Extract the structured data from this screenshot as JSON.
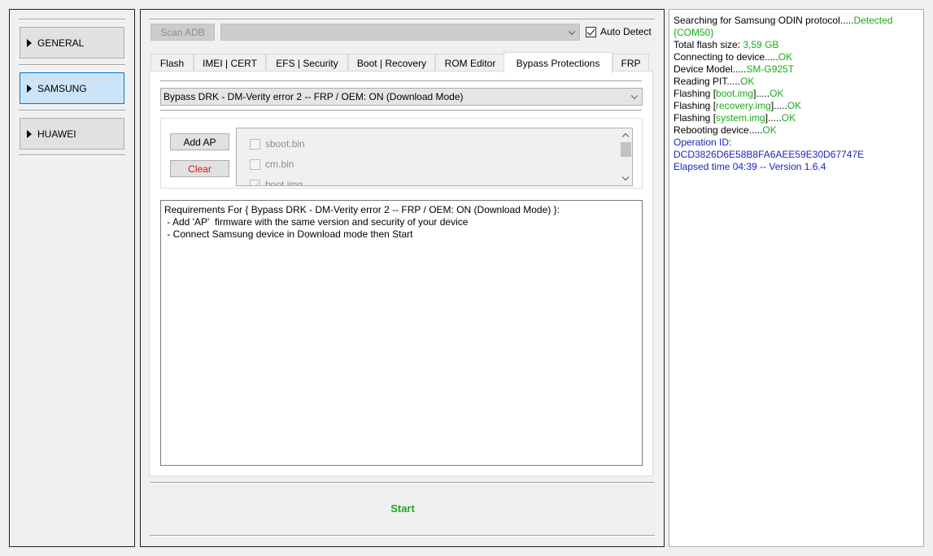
{
  "sidebar": {
    "items": [
      {
        "label": "GENERAL",
        "active": false
      },
      {
        "label": "SAMSUNG",
        "active": true
      },
      {
        "label": "HUAWEI",
        "active": false
      }
    ]
  },
  "toolbar": {
    "scan_adb_label": "Scan ADB",
    "device_combo_value": "",
    "auto_detect_label": "Auto Detect",
    "auto_detect_checked": true
  },
  "tabs": [
    {
      "label": "Flash"
    },
    {
      "label": "IMEI | CERT"
    },
    {
      "label": "EFS | Security"
    },
    {
      "label": "Boot | Recovery"
    },
    {
      "label": "ROM Editor"
    },
    {
      "label": "Bypass Protections",
      "active": true
    },
    {
      "label": "FRP"
    }
  ],
  "bypass": {
    "mode_value": "Bypass DRK - DM-Verity error 2 -- FRP / OEM: ON (Download Mode)",
    "add_ap_label": "Add AP",
    "clear_label": "Clear",
    "files": [
      {
        "name": "sboot.bin",
        "checked": false
      },
      {
        "name": "cm.bin",
        "checked": false
      },
      {
        "name": "boot.img",
        "checked": true
      }
    ],
    "requirements": [
      "Requirements For { Bypass DRK - DM-Verity error 2 -- FRP / OEM: ON (Download Mode) }:",
      " - Add 'AP'  firmware with the same version and security of your device",
      " - Connect Samsung device in Download mode then Start"
    ]
  },
  "start_label": "Start",
  "log": {
    "l1": "Searching for Samsung ODIN protocol.....",
    "l1_status": "Detected",
    "l2": "{COM50}",
    "l3": "Total flash size: ",
    "l3_value": "3,59 GB",
    "l4": "Connecting to device.....",
    "l4_status": "OK",
    "l5": "Device Model.....",
    "l5_value": "SM-G925T",
    "l6": "Reading PIT.....",
    "l6_status": "OK",
    "l7_prefix": "Flashing [",
    "l7_file": "boot.img",
    "l7_suffix": "].....",
    "l7_status": "OK",
    "l8_prefix": "Flashing [",
    "l8_file": "recovery.img",
    "l8_suffix": "].....",
    "l8_status": "OK",
    "l9_prefix": "Flashing [",
    "l9_file": "system.img",
    "l9_suffix": "].....",
    "l9_status": "OK",
    "l10": "Rebooting device.....",
    "l10_status": "OK",
    "l11": "Operation ID:",
    "l12": "DCD3826D6E58B8FA6AEE59E30D67747E",
    "l13": "Elapsed time 04:39 -- Version 1.6.4"
  },
  "colors": {
    "ok": "#1aab1a",
    "info": "#1c24c2",
    "clear_text": "#e01010",
    "active_nav": "#cce4f7"
  }
}
